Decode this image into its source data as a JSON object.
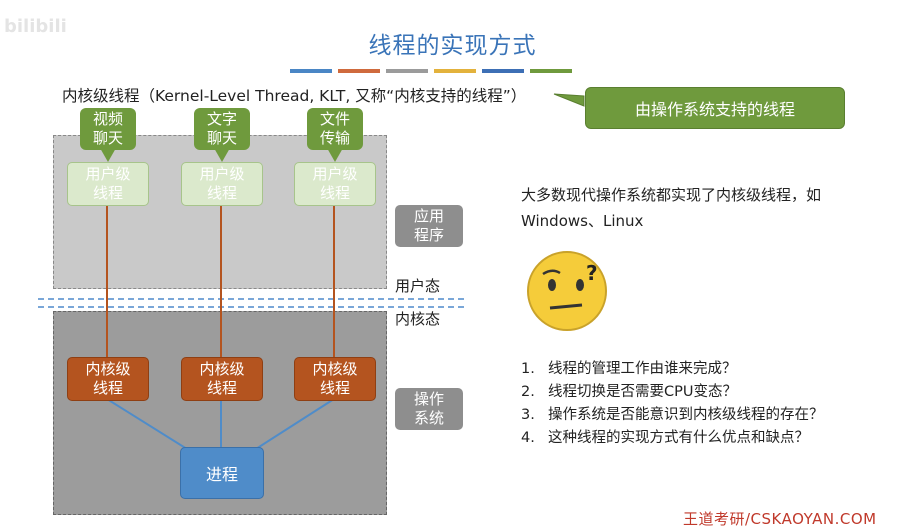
{
  "title": "线程的实现方式",
  "color_bars": [
    "#4a86c5",
    "#cf6a3d",
    "#9b9b9b",
    "#e3b23c",
    "#3d6fb5",
    "#6f9a3d"
  ],
  "klt_line": "内核级线程（Kernel-Level Thread, KLT, 又称“内核支持的线程”）",
  "callout": "由操作系统支持的线程",
  "apps": [
    "视频\n聊天",
    "文字\n聊天",
    "文件\n传输"
  ],
  "user_threads": [
    "用户级\n线程",
    "用户级\n线程",
    "用户级\n线程"
  ],
  "kernel_threads": [
    "内核级\n线程",
    "内核级\n线程",
    "内核级\n线程"
  ],
  "process": "进程",
  "side_labels": {
    "app": "应用\n程序",
    "os": "操作\n系统"
  },
  "modes": {
    "user": "用户态",
    "kernel": "内核态"
  },
  "description": "大多数现代操作系统都实现了内核级线程，如Windows、Linux",
  "questions": [
    {
      "num": "1.",
      "text": "线程的管理工作由谁来完成？"
    },
    {
      "num": "2.",
      "text": "线程切换是否需要CPU变态？"
    },
    {
      "num": "3.",
      "text": "操作系统是否能意识到内核级线程的存在？"
    },
    {
      "num": "4.",
      "text": "这种线程的实现方式有什么优点和缺点？"
    }
  ],
  "footer": "王道考研/CSKAOYAN.COM",
  "watermark": "bilibili",
  "colors": {
    "accent": "#3a74b8",
    "green": "#6f9a3d",
    "kernel": "#b4541f",
    "process": "#4f8cc9"
  }
}
